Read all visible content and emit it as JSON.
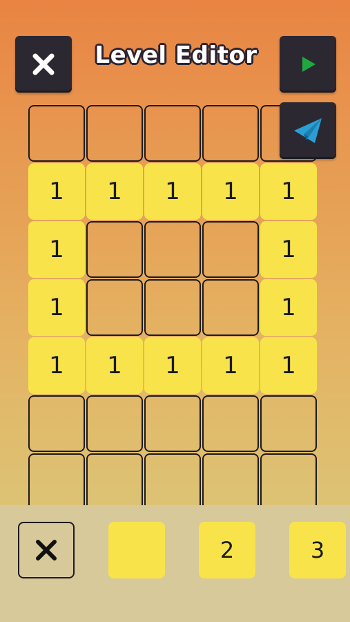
{
  "header": {
    "title": "Level Editor",
    "close_icon": "close-icon",
    "play_icon": "play-icon",
    "share_icon": "paper-plane-icon"
  },
  "colors": {
    "tile_fill": "#f8e44a",
    "button_dark": "#2c2832",
    "play_green": "#1fa83f",
    "plane_blue": "#2a9fd6",
    "palette_bg": "#d7c99a"
  },
  "grid": {
    "rows": [
      [
        "",
        "",
        "",
        "",
        ""
      ],
      [
        "1",
        "1",
        "1",
        "1",
        "1"
      ],
      [
        "1",
        "",
        "",
        "",
        "1"
      ],
      [
        "1",
        "",
        "",
        "",
        "1"
      ],
      [
        "1",
        "1",
        "1",
        "1",
        "1"
      ],
      [
        "",
        "",
        "",
        "",
        ""
      ],
      [
        "",
        "",
        "",
        "",
        ""
      ]
    ]
  },
  "palette": {
    "erase_icon": "close-icon",
    "blank_tile": "",
    "tile_2": "2",
    "tile_3": "3"
  }
}
